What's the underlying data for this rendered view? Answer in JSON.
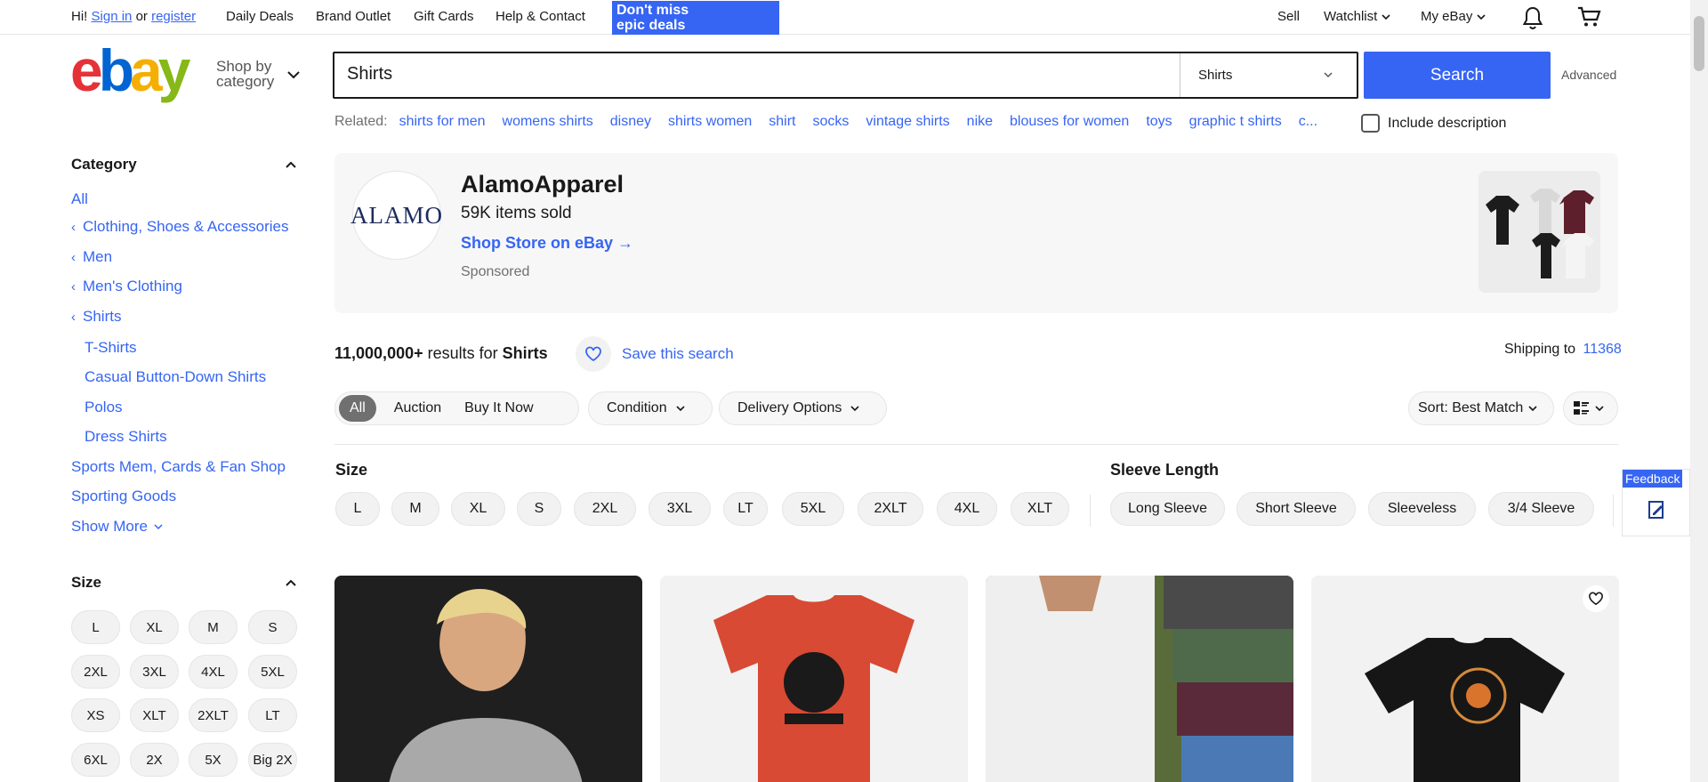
{
  "topbar": {
    "greeting": "Hi!",
    "sign_in": "Sign in",
    "or": "or",
    "register": "register",
    "links": [
      "Daily Deals",
      "Brand Outlet",
      "Gift Cards",
      "Help & Contact"
    ],
    "promo_line1": "Don't miss",
    "promo_line2": "epic deals",
    "sell": "Sell",
    "watchlist": "Watchlist",
    "my_ebay": "My eBay"
  },
  "header": {
    "shop_by_line1": "Shop by",
    "shop_by_line2": "category",
    "search_value": "Shirts",
    "category_select": "Shirts",
    "search_button": "Search",
    "advanced": "Advanced"
  },
  "related": {
    "label": "Related:",
    "items": [
      "shirts for men",
      "womens shirts",
      "disney",
      "shirts women",
      "shirt",
      "socks",
      "vintage shirts",
      "nike",
      "blouses for women",
      "toys",
      "graphic t shirts",
      "c..."
    ],
    "include_description": "Include description"
  },
  "sidebar": {
    "category_heading": "Category",
    "all": "All",
    "breadcrumbs": [
      "Clothing, Shoes & Accessories",
      "Men",
      "Men's Clothing",
      "Shirts"
    ],
    "subcats": [
      "T-Shirts",
      "Casual Button-Down Shirts",
      "Polos",
      "Dress Shirts"
    ],
    "others": [
      "Sports Mem, Cards & Fan Shop",
      "Sporting Goods"
    ],
    "show_more": "Show More",
    "size_heading": "Size",
    "sizes": [
      "L",
      "XL",
      "M",
      "S",
      "2XL",
      "3XL",
      "4XL",
      "5XL",
      "XS",
      "XLT",
      "2XLT",
      "LT",
      "6XL",
      "2X",
      "5X",
      "Big 2X"
    ]
  },
  "sponsored": {
    "logo_text": "ALAMO",
    "store_name": "AlamoApparel",
    "items_sold": "59K items sold",
    "shop_link": "Shop Store on eBay",
    "tag": "Sponsored"
  },
  "results": {
    "count": "11,000,000+",
    "results_for": "results for",
    "query": "Shirts",
    "save_search": "Save this search",
    "shipping_to": "Shipping to",
    "zip": "11368"
  },
  "filters": {
    "format": [
      "All",
      "Auction",
      "Buy It Now"
    ],
    "condition": "Condition",
    "delivery": "Delivery Options",
    "sort": "Sort: Best Match"
  },
  "size_filter": {
    "heading": "Size",
    "chips": [
      "L",
      "M",
      "XL",
      "S",
      "2XL",
      "3XL",
      "LT",
      "5XL",
      "2XLT",
      "4XL",
      "XLT"
    ]
  },
  "sleeve_filter": {
    "heading": "Sleeve Length",
    "chips": [
      "Long Sleeve",
      "Short Sleeve",
      "Sleeveless",
      "3/4 Sleeve"
    ]
  },
  "feedback": "Feedback",
  "colors": {
    "accent": "#3665f3",
    "text": "#191919",
    "muted": "#707070"
  }
}
